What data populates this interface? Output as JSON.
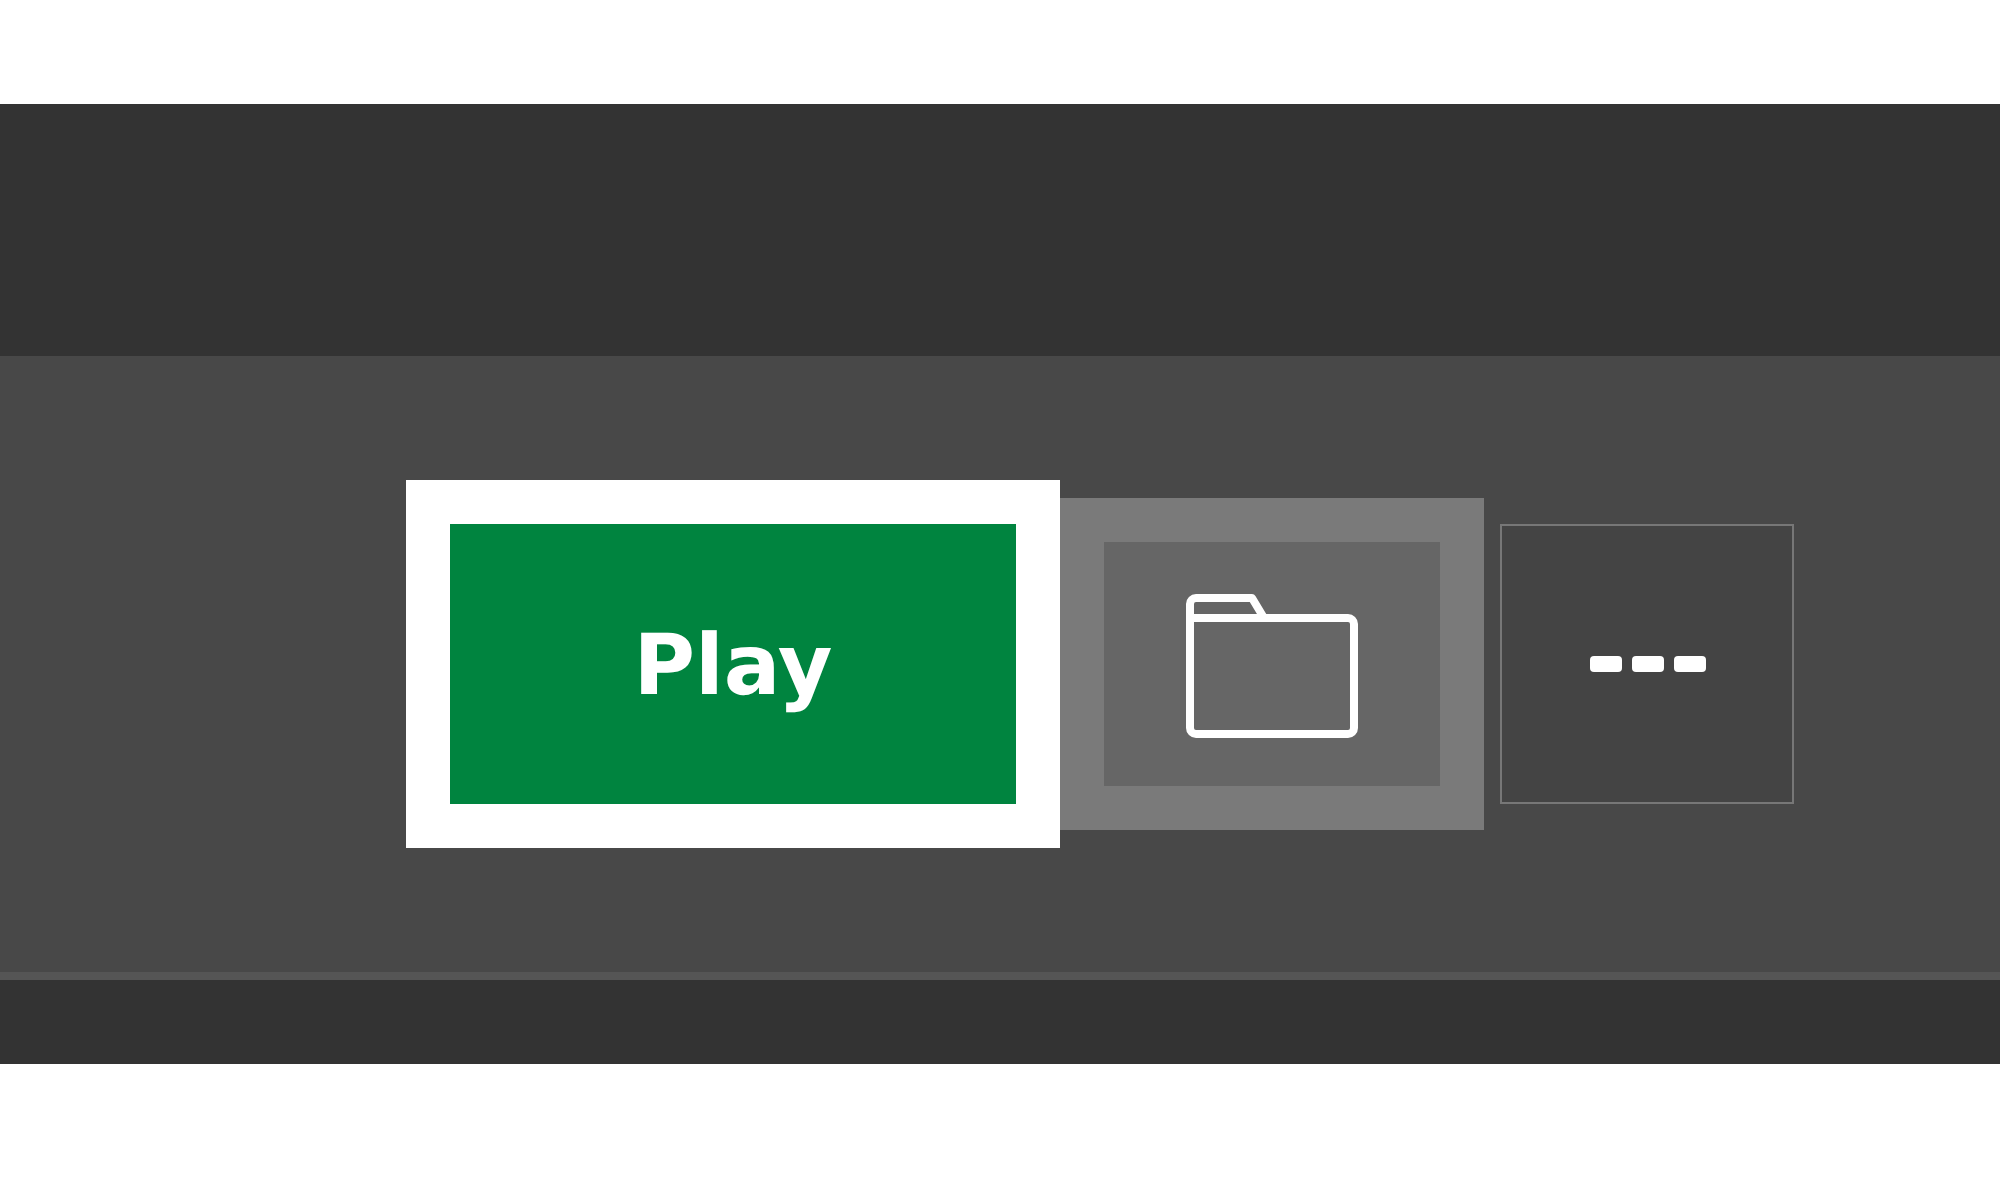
{
  "actions": [
    {
      "kind": "play",
      "label": "Play",
      "focused": true,
      "hovered": false
    },
    {
      "kind": "folder",
      "focused": false,
      "hovered": true
    },
    {
      "kind": "more",
      "focused": false,
      "hovered": false
    }
  ]
}
